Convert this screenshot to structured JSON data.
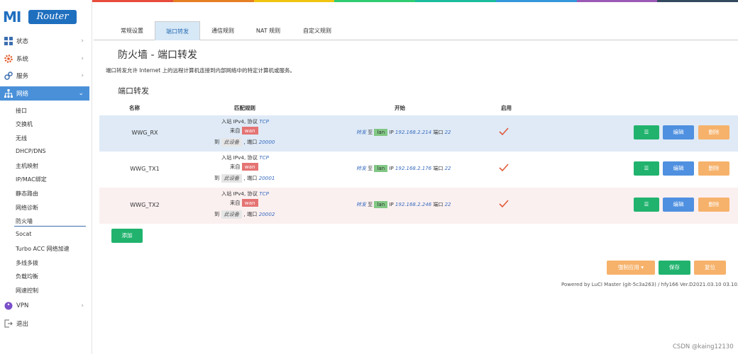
{
  "brand": {
    "logo_mi": "MI",
    "logo_router": "Router"
  },
  "topbar_colors": [
    "#e74c3c",
    "#e67e22",
    "#f1c40f",
    "#2ecc71",
    "#1abc9c",
    "#3498db",
    "#9b59b6",
    "#34495e"
  ],
  "sidebar": {
    "items": [
      {
        "label": "状态",
        "icon": "status-icon"
      },
      {
        "label": "系统",
        "icon": "gear-icon"
      },
      {
        "label": "服务",
        "icon": "services-icon"
      },
      {
        "label": "网络",
        "icon": "network-icon"
      }
    ],
    "network_sub": [
      "接口",
      "交换机",
      "无线",
      "DHCP/DNS",
      "主机映射",
      "IP/MAC绑定",
      "静态路由",
      "网络诊断",
      "防火墙",
      "Socat",
      "Turbo ACC 网络加速",
      "多线多拨",
      "负载均衡",
      "网速控制"
    ],
    "vpn_label": "VPN",
    "logout_label": "退出"
  },
  "tabs": [
    "常规设置",
    "端口转发",
    "通信规则",
    "NAT 规则",
    "自定义规则"
  ],
  "page": {
    "title": "防火墙 - 端口转发",
    "description": "端口转发允许 Internet 上的远程计算机连接到内部网络中的特定计算机或服务。",
    "section_title": "端口转发"
  },
  "table": {
    "headers": [
      "名称",
      "匹配规则",
      "开始",
      "启用"
    ],
    "rows": [
      {
        "name": "WWG_RX",
        "line1": "入站 IPv4, 协议",
        "proto": "TCP",
        "from_label": "来自",
        "from_zone": "wan",
        "to_label": "到",
        "to_dev": "此设备",
        "port_label": ", 端口",
        "port": "20000",
        "fwd": "转发",
        "fwd_to": "至",
        "dest_zone": "lan",
        "ip_label": "IP",
        "ip": "192.168.2.214",
        "dport_label": "端口",
        "dport": "22",
        "bg": "#dfeaf6"
      },
      {
        "name": "WWG_TX1",
        "line1": "入站 IPv4, 协议",
        "proto": "TCP",
        "from_label": "来自",
        "from_zone": "wan",
        "to_label": "到",
        "to_dev": "此设备",
        "port_label": ", 端口",
        "port": "20001",
        "fwd": "转发",
        "fwd_to": "至",
        "dest_zone": "lan",
        "ip_label": "IP",
        "ip": "192.168.2.176",
        "dport_label": "端口",
        "dport": "22",
        "bg": "#ffffff"
      },
      {
        "name": "WWG_TX2",
        "line1": "入站 IPv4, 协议",
        "proto": "TCP",
        "from_label": "来自",
        "from_zone": "wan",
        "to_label": "到",
        "to_dev": "此设备",
        "port_label": ", 端口",
        "port": "20002",
        "fwd": "转发",
        "fwd_to": "至",
        "dest_zone": "lan",
        "ip_label": "IP",
        "ip": "192.168.2.246",
        "dport_label": "端口",
        "dport": "22",
        "bg": "#fbf0f0"
      }
    ],
    "menu_label": "☰",
    "edit_label": "编辑",
    "delete_label": "删除"
  },
  "buttons": {
    "add": "添加",
    "apply": "强制应用 ▾",
    "save": "保存",
    "reset": "复位"
  },
  "footer": "Powered by LuCI Master (git-5c3a263) / hfy166 Ver.D2021.03.10 03.10.2021",
  "watermark": "CSDN @kaing12130"
}
